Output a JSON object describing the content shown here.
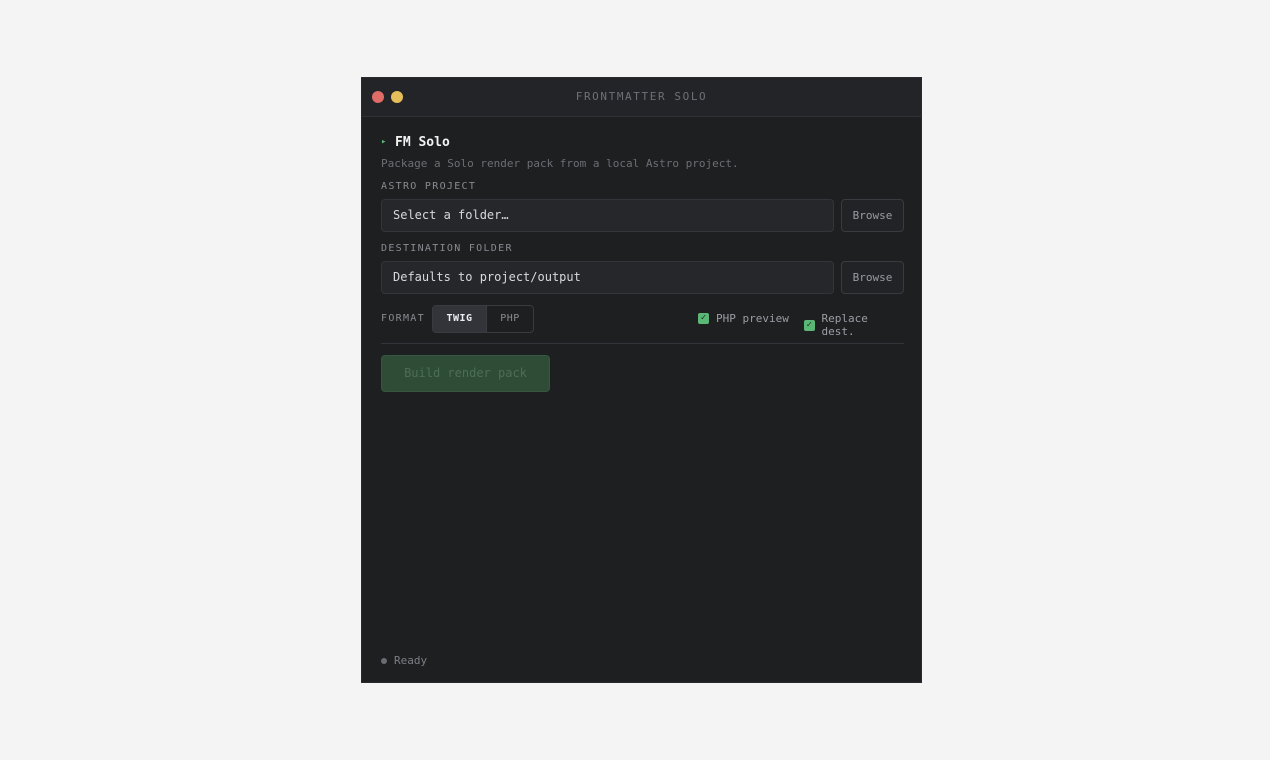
{
  "window": {
    "title": "FRONTMATTER SOLO"
  },
  "header": {
    "app_name": "FM Solo",
    "subtitle": "Package a Solo render pack from a local Astro project."
  },
  "astro_project": {
    "label": "ASTRO PROJECT",
    "placeholder": "Select a folder…",
    "browse_label": "Browse"
  },
  "destination": {
    "label": "DESTINATION FOLDER",
    "placeholder": "Defaults to project/output",
    "browse_label": "Browse"
  },
  "format": {
    "label": "FORMAT",
    "options": [
      "TWIG",
      "PHP"
    ],
    "selected": "TWIG"
  },
  "options": {
    "php_preview": {
      "label": "PHP preview",
      "checked": true
    },
    "replace_dest": {
      "label": "Replace dest.",
      "checked": true
    }
  },
  "actions": {
    "build_label": "Build render pack"
  },
  "status": {
    "text": "Ready"
  },
  "colors": {
    "accent": "#5ab775",
    "background": "#1e1f21",
    "close": "#e06c67",
    "minimize": "#e5be5a"
  }
}
